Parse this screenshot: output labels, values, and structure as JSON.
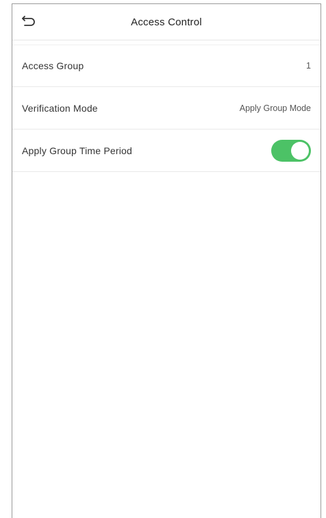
{
  "header": {
    "title": "Access Control",
    "back_icon": "back-arrow-icon"
  },
  "rows": [
    {
      "label": "Access Group",
      "value": "1"
    },
    {
      "label": "Verification Mode",
      "value": "Apply Group Mode"
    },
    {
      "label": "Apply Group Time Period",
      "toggle_on": true
    }
  ],
  "colors": {
    "toggle_on": "#4cc266"
  }
}
